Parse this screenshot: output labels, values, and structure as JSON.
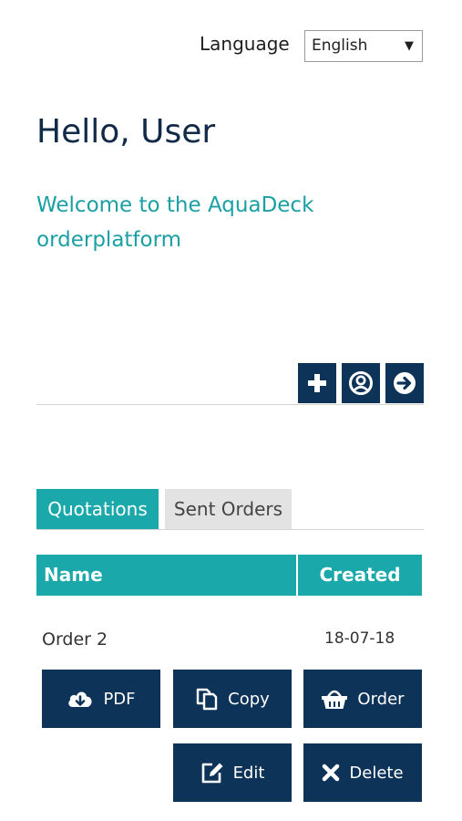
{
  "header": {
    "language_label": "Language",
    "language_selected": "English"
  },
  "greeting": {
    "title": "Hello, User",
    "welcome_line1": "Welcome to the AquaDeck",
    "welcome_line2": "orderplatform"
  },
  "toolbar": {
    "icons": [
      "plus-icon",
      "user-icon",
      "arrow-right-circle-icon"
    ]
  },
  "tabs": [
    {
      "label": "Quotations",
      "active": true
    },
    {
      "label": "Sent Orders",
      "active": false
    }
  ],
  "table": {
    "columns": [
      "Name",
      "Created"
    ],
    "rows": [
      {
        "name": "Order 2",
        "created": "18-07-18"
      }
    ]
  },
  "actions": {
    "pdf": "PDF",
    "copy": "Copy",
    "order": "Order",
    "edit": "Edit",
    "delete": "Delete"
  },
  "colors": {
    "primary_dark": "#0e3358",
    "accent_teal": "#1aa8ab",
    "tab_inactive": "#e3e3e3"
  }
}
